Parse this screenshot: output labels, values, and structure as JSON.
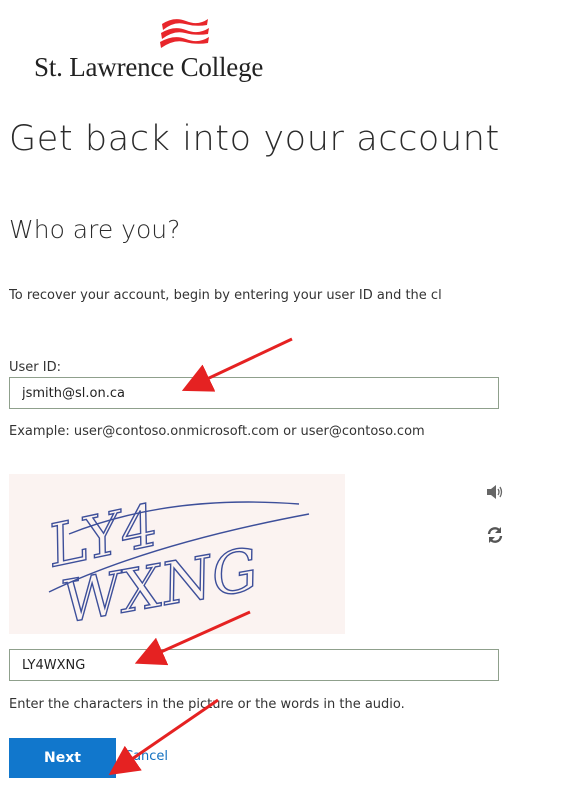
{
  "brand": {
    "name": "St. Lawrence College",
    "logo_icon": "red-flag-waves-icon",
    "accent_color": "#e8262b"
  },
  "page": {
    "title": "Get back into your account",
    "section_title": "Who are you?",
    "instructions": "To recover your account, begin by entering your user ID and the cl"
  },
  "user_id": {
    "label": "User ID:",
    "value": "jsmith@sl.on.ca",
    "example": "Example: user@contoso.onmicrosoft.com or user@contoso.com"
  },
  "captcha": {
    "image_text": "LY4WXNG",
    "audio_icon": "speaker-icon",
    "refresh_icon": "refresh-icon",
    "value": "LY4WXNG",
    "hint": "Enter the characters in the picture or the words in the audio."
  },
  "actions": {
    "next_label": "Next",
    "next_color": "#1177cc",
    "cancel_label": "Cancel"
  },
  "annotations": {
    "arrow_color": "#e52222"
  }
}
